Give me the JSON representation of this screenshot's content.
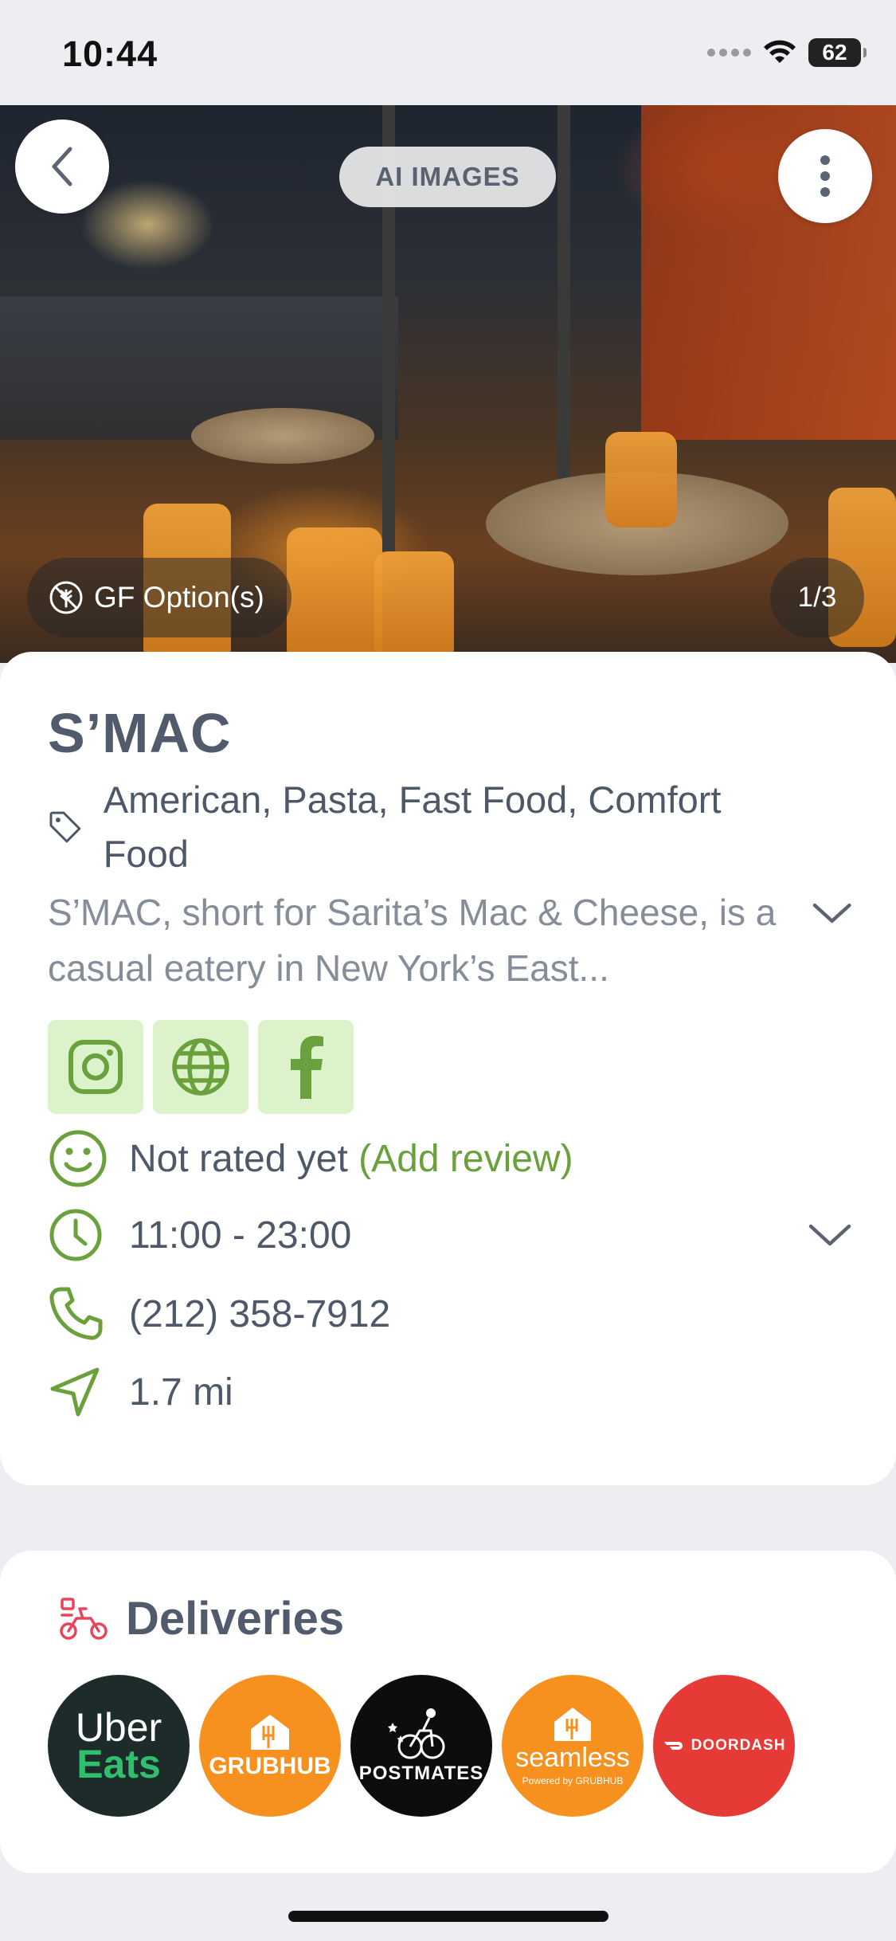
{
  "status_bar": {
    "time": "10:44",
    "battery": "62"
  },
  "hero": {
    "ai_images_label": "AI IMAGES",
    "gf_label": "GF Option(s)",
    "counter": "1/3"
  },
  "restaurant": {
    "name": "S’MAC",
    "categories": "American, Pasta, Fast Food, Comfort Food",
    "description": "S’MAC, short for Sarita’s Mac & Cheese, is a casual eatery in New York’s East...",
    "rating_text": "Not rated yet",
    "add_review": "(Add review)",
    "hours": "11:00 - 23:00",
    "phone": "(212) 358-7912",
    "distance": "1.7 mi"
  },
  "socials": [
    "instagram",
    "website",
    "facebook"
  ],
  "deliveries": {
    "title": "Deliveries",
    "services": {
      "uber_line1": "Uber",
      "uber_line2": "Eats",
      "grubhub": "GRUBHUB",
      "postmates": "POSTMATES",
      "seamless": "seamless",
      "seamless_sub": "Powered by GRUBHUB",
      "doordash": "DOORDASH"
    }
  },
  "colors": {
    "accent_green": "#6aa13c",
    "social_bg": "#dcf2cb",
    "delivery_icon": "#e8455a"
  }
}
